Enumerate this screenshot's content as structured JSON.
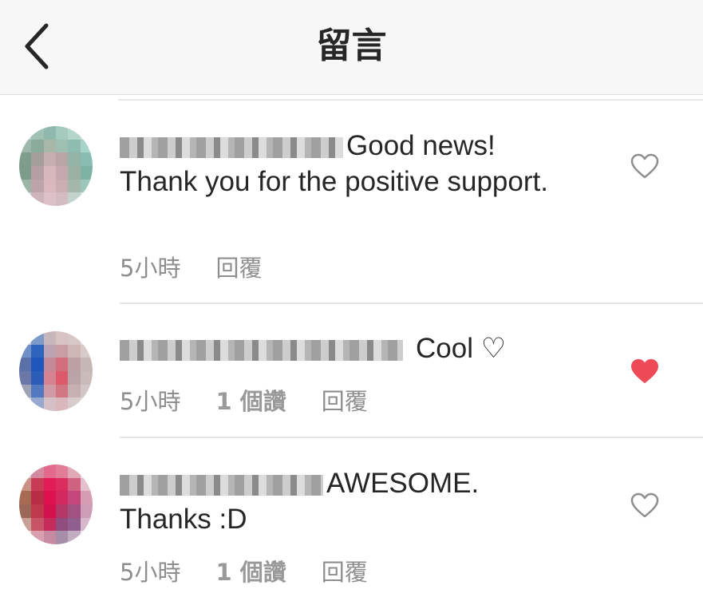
{
  "header": {
    "title": "留言",
    "back_icon": "chevron-left-icon"
  },
  "comments": [
    {
      "text": "Good news! Thank you for the positive support.",
      "time": "5小時",
      "likes": "",
      "reply": "回覆",
      "liked": false
    },
    {
      "text": "Cool ♡",
      "time": "5小時",
      "likes": "1 個讚",
      "reply": "回覆",
      "liked": true
    },
    {
      "text": "AWESOME. Thanks :D",
      "time": "5小時",
      "likes": "1 個讚",
      "reply": "回覆",
      "liked": false
    }
  ],
  "colors": {
    "like_red": "#ed4956",
    "meta_gray": "#8e8e8e",
    "header_bg": "#f7f7f7"
  }
}
